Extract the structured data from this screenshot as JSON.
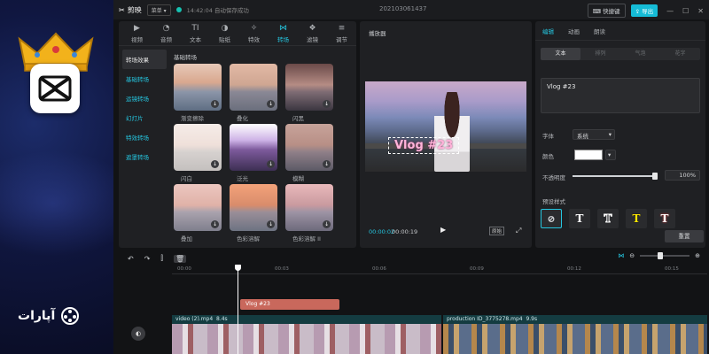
{
  "app": {
    "logo_label": "剪映",
    "menu_label": "菜单",
    "status_time": "14:42:04",
    "status_text": "自动保存成功",
    "project_name": "202103061437",
    "shortcut_label": "快捷键",
    "export_label": "导出"
  },
  "media_tabs": [
    {
      "label": "视频",
      "icon": "video-icon"
    },
    {
      "label": "音频",
      "icon": "audio-icon"
    },
    {
      "label": "文本",
      "icon": "text-icon"
    },
    {
      "label": "贴纸",
      "icon": "sticker-icon"
    },
    {
      "label": "特效",
      "icon": "effects-icon"
    },
    {
      "label": "转场",
      "icon": "transition-icon"
    },
    {
      "label": "滤镜",
      "icon": "filter-icon"
    },
    {
      "label": "调节",
      "icon": "adjust-icon"
    }
  ],
  "categories": [
    {
      "label": "转场效果",
      "selected": true
    },
    {
      "label": "基础转场"
    },
    {
      "label": "运镜转场"
    },
    {
      "label": "幻灯片"
    },
    {
      "label": "特效转场"
    },
    {
      "label": "遮罩转场"
    }
  ],
  "section_title": "基础转场",
  "transitions": [
    {
      "label": "渐变擦除"
    },
    {
      "label": "叠化"
    },
    {
      "label": "闪黑"
    },
    {
      "label": "闪白"
    },
    {
      "label": "泛光"
    },
    {
      "label": "模糊"
    },
    {
      "label": "叠加"
    },
    {
      "label": "色彩溶解"
    },
    {
      "label": "色彩溶解 II"
    }
  ],
  "player": {
    "title": "播放器",
    "caption": "Vlog #23",
    "time_current": "00:00:02",
    "time_total": "00:00:19",
    "ratio_label": "原始"
  },
  "properties": {
    "tabs": [
      "编辑",
      "动画",
      "朗读"
    ],
    "sub_tabs": [
      "文本",
      "排列",
      "气泡",
      "花字"
    ],
    "text_value": "Vlog #23",
    "font_label": "字体",
    "font_value": "系统",
    "color_label": "颜色",
    "opacity_label": "不透明度",
    "opacity_value": "100%",
    "opacity_fraction": 1.0,
    "preset_label": "预设样式",
    "preset_letter": "T",
    "reset_label": "重置"
  },
  "colors": {
    "accent": "#25c6e0",
    "export": "#15bbd6",
    "text_clip": "#c9685c"
  },
  "timeline": {
    "ticks": [
      "00:00",
      "00:03",
      "00:06",
      "00:09",
      "00:12",
      "00:15"
    ],
    "text_clip": "Vlog #23",
    "clip1_name": "video (2).mp4",
    "clip1_duration": "8.4s",
    "clip2_name": "production ID_3775278.mp4",
    "clip2_duration": "9.9s"
  },
  "overlay": {
    "brand_text": "آپارات"
  }
}
